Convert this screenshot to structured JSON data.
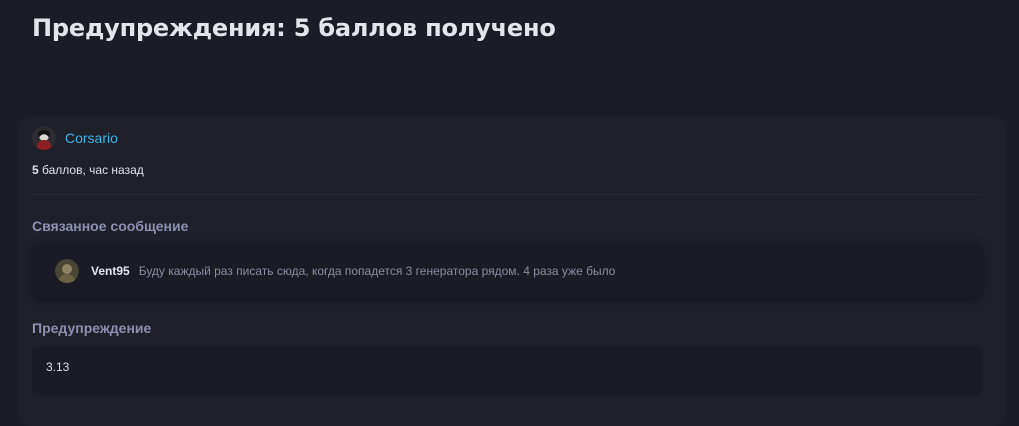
{
  "page": {
    "title": "Предупреждения: 5 баллов получено"
  },
  "warning_card": {
    "author": "Corsario",
    "points_value": "5",
    "points_suffix": " баллов, час назад",
    "related_heading": "Связанное сообщение",
    "related_post": {
      "author": "Vent95",
      "text": "Буду каждый раз писать сюда, когда попадется 3 генератора рядом. 4 раза уже было"
    },
    "warning_heading": "Предупреждение",
    "warning_value": "3.13"
  },
  "colors": {
    "background": "#1b1c25",
    "card": "#1f2029",
    "link": "#3fb4ea",
    "heading_muted": "#8d90b0"
  }
}
